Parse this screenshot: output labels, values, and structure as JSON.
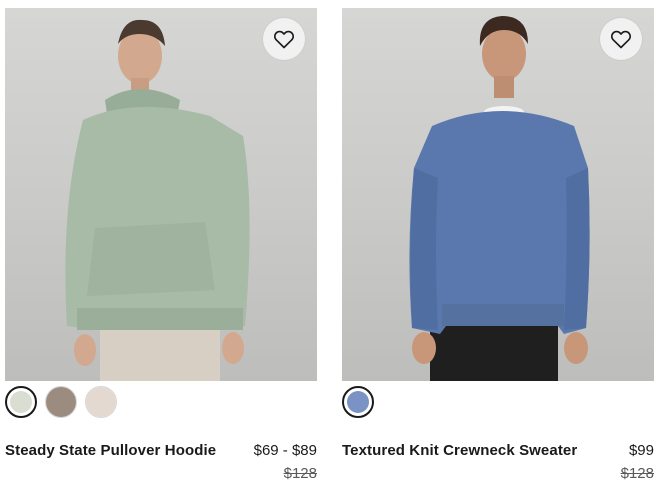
{
  "products": [
    {
      "name": "Steady State Pullover Hoodie",
      "price": "$69 - $89",
      "original_price": "$128",
      "wishlist_icon": "heart-outline-icon",
      "swatches": [
        {
          "color": "#d9ddd2",
          "selected": true
        },
        {
          "color": "#9c8c80",
          "selected": false
        },
        {
          "color": "#e4d9d1",
          "selected": false
        }
      ]
    },
    {
      "name": "Textured Knit Crewneck Sweater",
      "price": "$99",
      "original_price": "$128",
      "wishlist_icon": "heart-outline-icon",
      "swatches": [
        {
          "color": "#7a93c4",
          "selected": true
        }
      ]
    }
  ],
  "colors": {
    "photo_bg": "#cfcfcd",
    "hoodie": "#a7bba6",
    "sweater": "#5a78ad",
    "text": "#1a1a1a",
    "muted": "#5a5a5a"
  }
}
